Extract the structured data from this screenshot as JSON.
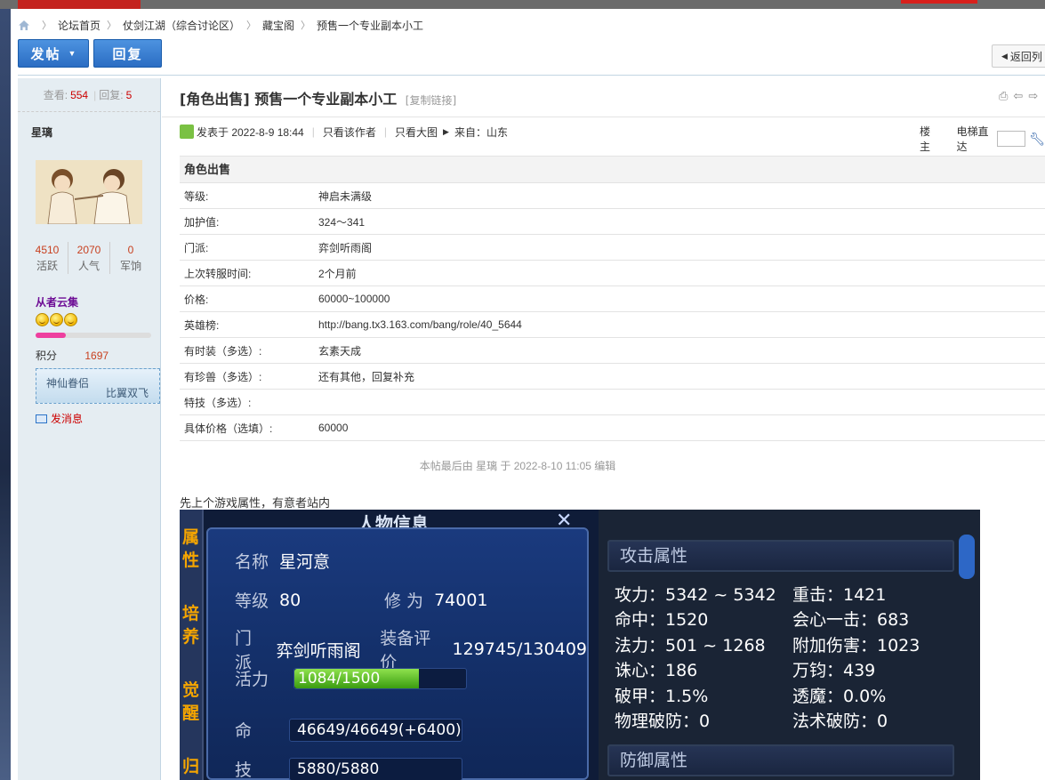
{
  "breadcrumb": [
    "论坛首页",
    "仗剑江湖（综合讨论区）",
    "藏宝阁",
    "预售一个专业副本小工"
  ],
  "toolbar": {
    "post_label": "发帖",
    "reply_label": "回复",
    "back_label": "返回列"
  },
  "author": {
    "views_label": "查看:",
    "views": "554",
    "replies_label": "回复:",
    "replies": "5",
    "name": "星璃",
    "counts": [
      {
        "num": "4510",
        "label": "活跃"
      },
      {
        "num": "2070",
        "label": "人气"
      },
      {
        "num": "0",
        "label": "军饷"
      }
    ],
    "group": "从者云集",
    "level_progress": 0.26,
    "score_label": "积分",
    "score": "1697",
    "medal_a": "神仙眷侣",
    "medal_b": "比翼双飞",
    "message_label": "发消息"
  },
  "post": {
    "title": "[角色出售] 预售一个专业副本小工",
    "copy_link": "[复制链接]",
    "posted_at": "发表于 2022-8-9 18:44",
    "only_author": "只看该作者",
    "only_large": "只看大图",
    "from": "来自：山东",
    "floor_label": "楼主",
    "jump_label": "电梯直达",
    "table_caption": "角色出售",
    "fields": [
      {
        "k": "等级:",
        "v": "神启未满级"
      },
      {
        "k": "加护值:",
        "v": "324～341"
      },
      {
        "k": "门派:",
        "v": "弈剑听雨阁"
      },
      {
        "k": "上次转服时间:",
        "v": "2个月前"
      },
      {
        "k": "价格:",
        "v": "60000~100000"
      },
      {
        "k": "英雄榜:",
        "v": "http://bang.tx3.163.com/bang/role/40_5644"
      },
      {
        "k": "有时装（多选）:",
        "v": "玄素天成"
      },
      {
        "k": "有珍兽（多选）:",
        "v": "还有其他，回复补充"
      },
      {
        "k": "特技（多选）:",
        "v": ""
      },
      {
        "k": "具体价格（选填）:",
        "v": "60000"
      }
    ],
    "edit_note": "本帖最后由 星璃 于 2022-8-10 11:05 编辑",
    "intro": "先上个游戏属性，有意者站内"
  },
  "game": {
    "header": "人物信息",
    "tabs": [
      "属",
      "性",
      "培",
      "养",
      "觉",
      "醒",
      "归"
    ],
    "name_label": "名称",
    "name": "星河意",
    "level_label": "等级",
    "level": "80",
    "cult_label": "修 为",
    "cult": "74001",
    "school_label": "门派",
    "school": "弈剑听雨阁",
    "gear_label": "装备评价",
    "gear": "129745/130409",
    "vigor_label": "活力",
    "vigor": "1084/1500",
    "vigor_ratio": 0.723,
    "hp_label": "命",
    "hp": "46649/46649(+6400)",
    "skill_label": "技",
    "skill": "5880/5880",
    "attack_title": "攻击属性",
    "attack": [
      [
        "攻力：5342 ~ 5342",
        "重击：1421"
      ],
      [
        "命中：1520",
        "会心一击：683"
      ],
      [
        "法力：501 ~ 1268",
        "附加伤害：1023"
      ],
      [
        "诛心：186",
        "万钧：439"
      ],
      [
        "破甲：1.5%",
        "透魔：0.0%"
      ],
      [
        "物理破防：0",
        "法术破防：0"
      ]
    ],
    "defense_title": "防御属性"
  }
}
